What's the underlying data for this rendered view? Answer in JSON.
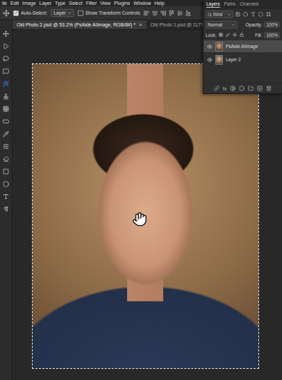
{
  "menu": [
    "ile",
    "Edit",
    "Image",
    "Layer",
    "Type",
    "Select",
    "Filter",
    "View",
    "Plugins",
    "Window",
    "Help"
  ],
  "options": {
    "auto_select": {
      "label": "Auto-Select:",
      "checked": true
    },
    "target": "Layer",
    "transform": {
      "label": "Show Transform Controls",
      "checked": false
    }
  },
  "documents": [
    {
      "title": "Old Photo 2.psd @ 53.2% (PsAide AIImage, RGB/8#) *",
      "close": "×",
      "selected": true
    },
    {
      "title": "Old Photo 1.psd @ 117%",
      "close": "",
      "selected": false
    }
  ],
  "tools": [
    {
      "selected": false
    },
    {
      "selected": false
    },
    {
      "selected": false
    },
    {
      "selected": false
    },
    {
      "selected": true
    },
    {
      "selected": false
    },
    {
      "selected": false
    },
    {
      "selected": false
    },
    {
      "selected": false
    },
    {
      "selected": false
    },
    {
      "selected": false
    },
    {
      "selected": false
    },
    {
      "selected": false
    },
    {
      "selected": false
    },
    {
      "selected": false
    }
  ],
  "layers_panel": {
    "tabs": [
      {
        "label": "Layers",
        "selected": true
      },
      {
        "label": "Paths",
        "selected": false
      },
      {
        "label": "Channels",
        "selected": false
      }
    ],
    "filter": "Kind",
    "blend": "Normal",
    "opacity_label": "Opacity:",
    "opacity": "100%",
    "lock_label": "Lock:",
    "fill_label": "Fill:",
    "fill": "100%",
    "layers": [
      {
        "name": "PsAide AIImage",
        "visible": true,
        "selected": true
      },
      {
        "name": "Layer 2",
        "visible": true,
        "selected": false
      }
    ],
    "footer_fx": "fx"
  }
}
